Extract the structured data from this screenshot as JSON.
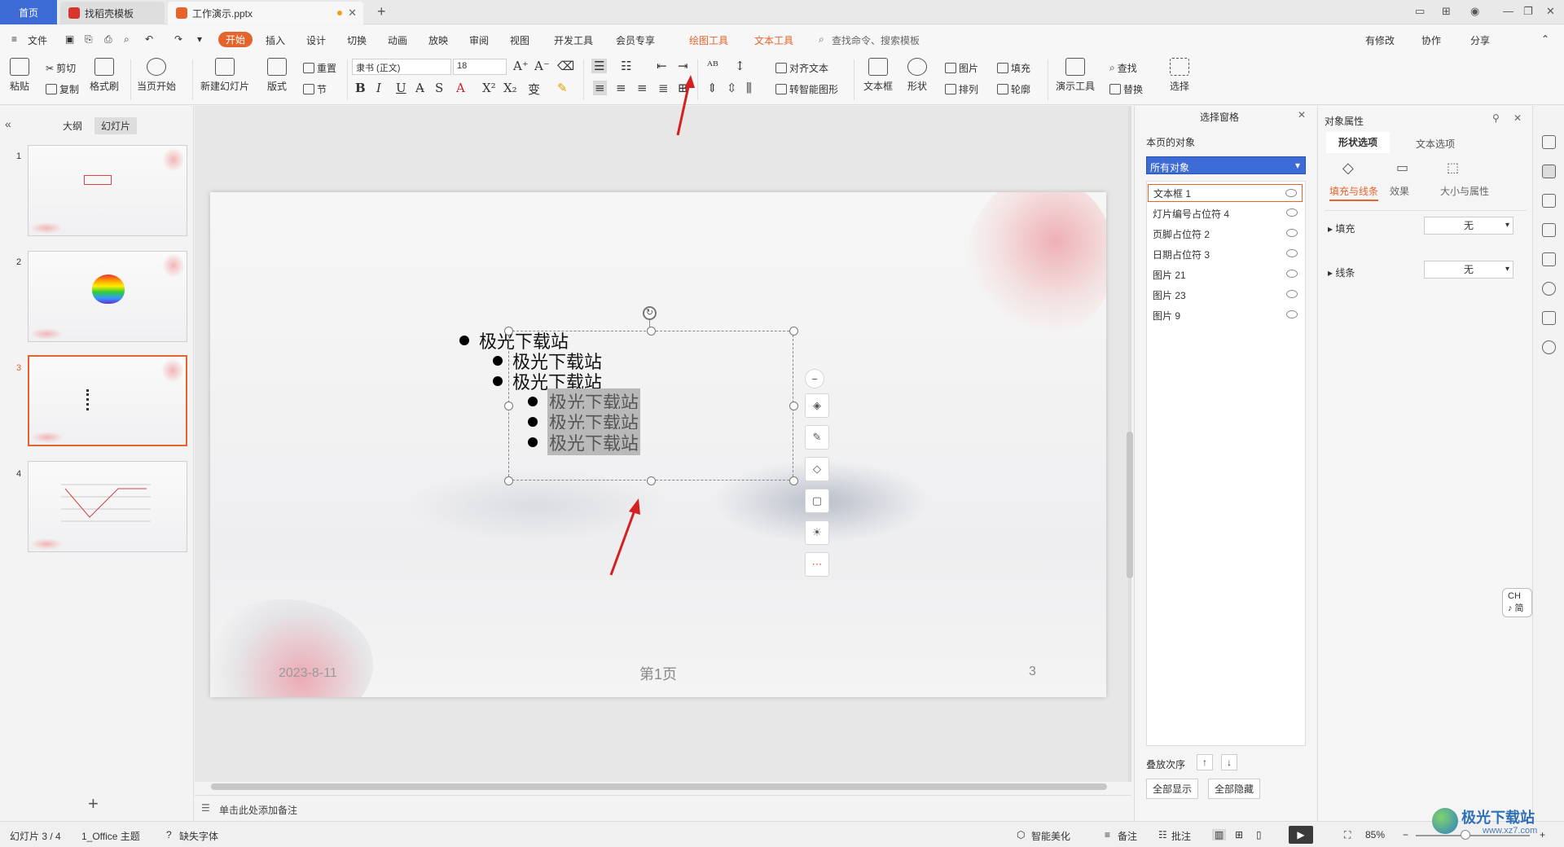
{
  "titlebar": {
    "tabs": [
      {
        "label": "首页"
      },
      {
        "label": "找稻壳模板"
      },
      {
        "label": "工作演示.pptx"
      }
    ],
    "new_tab": "+"
  },
  "menubar": {
    "file": "文件",
    "start_label": "开始",
    "items": [
      "插入",
      "设计",
      "切换",
      "动画",
      "放映",
      "审阅",
      "视图",
      "开发工具",
      "会员专享"
    ],
    "drawing_tools": "绘图工具",
    "text_tools": "文本工具",
    "search": "查找命令、搜索模板",
    "right": [
      "有修改",
      "协作",
      "分享"
    ]
  },
  "ribbon": {
    "paste": "粘贴",
    "cut": "剪切",
    "copy": "复制",
    "format_painter": "格式刷",
    "from_current": "当页开始",
    "new_slide": "新建幻灯片",
    "layout": "版式",
    "reset": "重置",
    "section": "节",
    "font_name": "隶书 (正文)",
    "font_size": "18",
    "align_text": "对齐文本",
    "smartart": "转智能图形",
    "textbox": "文本框",
    "shape": "形状",
    "picture": "图片",
    "arrange": "排列",
    "fill": "填充",
    "outline": "轮廓",
    "present_tools": "演示工具",
    "find": "查找",
    "replace": "替换",
    "select": "选择"
  },
  "leftpanel": {
    "tabs": [
      "大纲",
      "幻灯片"
    ],
    "slides": [
      "1",
      "2",
      "3",
      "4"
    ],
    "add": "+"
  },
  "slide": {
    "lines": [
      {
        "text": "极光下载站",
        "level": 1,
        "highlight": false
      },
      {
        "text": "极光下载站",
        "level": 2,
        "highlight": false
      },
      {
        "text": "极光下载站",
        "level": 2,
        "highlight": false
      },
      {
        "text": "极光下载站",
        "level": 3,
        "highlight": true
      },
      {
        "text": "极光下载站",
        "level": 3,
        "highlight": true
      },
      {
        "text": "极光下载站",
        "level": 3,
        "highlight": true
      }
    ],
    "date": "2023-8-11",
    "footer": "第1页",
    "page_number": "3"
  },
  "notes_placeholder": "单击此处添加备注",
  "selection_pane": {
    "title": "选择窗格",
    "section": "本页的对象",
    "filter": "所有对象",
    "objects": [
      "文本框 1",
      "灯片编号占位符 4",
      "页脚占位符 2",
      "日期占位符 3",
      "图片 21",
      "图片 23",
      "图片 9"
    ],
    "order_label": "叠放次序",
    "show_all": "全部显示",
    "hide_all": "全部隐藏"
  },
  "props_pane": {
    "title": "对象属性",
    "tabs": [
      "形状选项",
      "文本选项"
    ],
    "subtabs": [
      "填充与线条",
      "效果",
      "大小与属性"
    ],
    "fill_label": "填充",
    "fill_value": "无",
    "line_label": "线条",
    "line_value": "无"
  },
  "ime": "CH ♪ 简",
  "statusbar": {
    "slide_counter": "幻灯片 3 / 4",
    "theme": "1_Office 主题",
    "missing_font": "缺失字体",
    "smart": "智能美化",
    "notes": "备注",
    "comments": "批注",
    "zoom": "85%"
  },
  "watermark": "极光下载站",
  "watermark_url": "www.xz7.com",
  "colors": {
    "accent": "#e5632c",
    "home_tab": "#3d6bd6",
    "arrow": "#d42020"
  }
}
